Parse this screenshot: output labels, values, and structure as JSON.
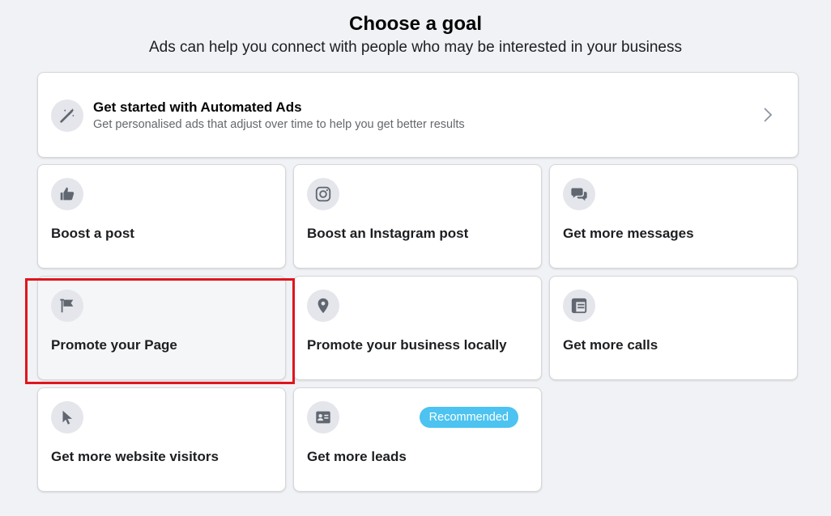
{
  "header": {
    "title": "Choose a goal",
    "subtitle": "Ads can help you connect with people who may be interested in your business"
  },
  "automated_ads": {
    "title": "Get started with Automated Ads",
    "description": "Get personalised ads that adjust over time to help you get better results",
    "icon": "magic-wand-icon"
  },
  "goals": [
    {
      "label": "Boost a post",
      "icon": "thumbs-up-icon"
    },
    {
      "label": "Boost an Instagram post",
      "icon": "instagram-icon"
    },
    {
      "label": "Get more messages",
      "icon": "chat-bubbles-icon"
    },
    {
      "label": "Promote your Page",
      "icon": "flag-icon",
      "selected": true
    },
    {
      "label": "Promote your business locally",
      "icon": "location-pin-icon"
    },
    {
      "label": "Get more calls",
      "icon": "phone-book-icon"
    },
    {
      "label": "Get more website visitors",
      "icon": "cursor-icon"
    },
    {
      "label": "Get more leads",
      "icon": "contact-card-icon",
      "badge": "Recommended"
    }
  ],
  "colors": {
    "background": "#f0f2f5",
    "badge": "#4cc3f0",
    "highlight": "#e0151c",
    "icon": "#606770"
  }
}
